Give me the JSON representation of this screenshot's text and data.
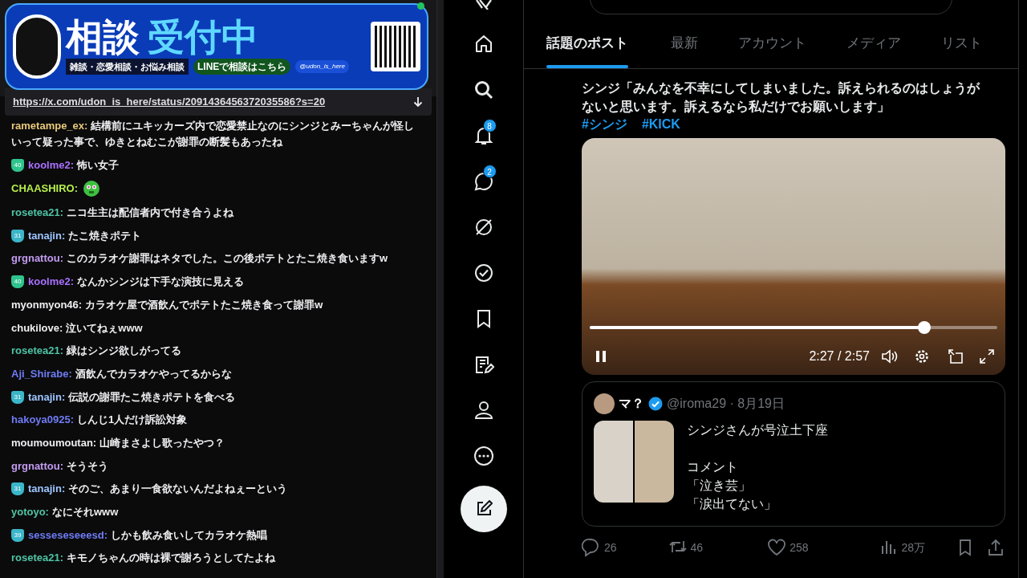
{
  "overlay_banner": {
    "title_left": "相談",
    "title_right": "受付中",
    "subtitle": "雑談・恋愛相談・お悩み相談",
    "line_button": "LINEで相談はこちら",
    "x_handle": "@udon_is_here"
  },
  "chat": {
    "pinned_link": "https://x.com/udon_is_here/status/2091436456372035586?s=20",
    "messages": [
      {
        "kind": "text",
        "user": "rametampe_ex:",
        "color": "#e8c97a",
        "text": "結構前にユキッカーズ内で恋愛禁止なのにシンジとみーちゃんが怪しいって疑った事で、ゆきとねむこが謝罪の断髪もあったね"
      },
      {
        "kind": "text",
        "user": "koolme2:",
        "color": "#a970ff",
        "badge": {
          "text": "40",
          "color": "#2fc48d"
        },
        "text": "怖い女子"
      },
      {
        "kind": "emote",
        "user": "CHAASHIRO:",
        "color": "#b7ef4b"
      },
      {
        "kind": "text",
        "user": "rosetea21:",
        "color": "#4fc4a4",
        "text": "ニコ生主は配信者内で付き合うよね"
      },
      {
        "kind": "text",
        "user": "tanajin:",
        "color": "#9ec6ff",
        "badge": {
          "text": "31",
          "color": "#3bb6c9"
        },
        "text": "たこ焼きポテト"
      },
      {
        "kind": "text",
        "user": "grgnattou:",
        "color": "#c49cf0",
        "text": "このカラオケ謝罪はネタでした。この後ポテトとたこ焼き食いますw"
      },
      {
        "kind": "text",
        "user": "koolme2:",
        "color": "#a970ff",
        "badge": {
          "text": "40",
          "color": "#2fc48d"
        },
        "text": "なんかシンジは下手な演技に見える"
      },
      {
        "kind": "text",
        "user": "myonmyon46:",
        "color": "#efeff1",
        "text": "カラオケ屋で酒飲んでポテトたこ焼き食って謝罪w"
      },
      {
        "kind": "text",
        "user": "chukilove:",
        "color": "#efeff1",
        "text": "泣いてねぇwww"
      },
      {
        "kind": "text",
        "user": "rosetea21:",
        "color": "#4fc4a4",
        "text": "緑はシンジ欲しがってる"
      },
      {
        "kind": "text",
        "user": "Aji_Shirabe:",
        "color": "#6f7cf5",
        "text": "酒飲んでカラオケやってるからな"
      },
      {
        "kind": "text",
        "user": "tanajin:",
        "color": "#9ec6ff",
        "badge": {
          "text": "31",
          "color": "#3bb6c9"
        },
        "text": "伝説の謝罪たこ焼きポテトを食べる"
      },
      {
        "kind": "text",
        "user": "hakoya0925:",
        "color": "#6f7cf5",
        "text": "しんじ1人だけ訴訟対象"
      },
      {
        "kind": "text",
        "user": "moumoumoutan:",
        "color": "#efeff1",
        "text": "山崎まさよし歌ったやつ？"
      },
      {
        "kind": "text",
        "user": "grgnattou:",
        "color": "#c49cf0",
        "text": "そうそう"
      },
      {
        "kind": "text",
        "user": "tanajin:",
        "color": "#9ec6ff",
        "badge": {
          "text": "31",
          "color": "#3bb6c9"
        },
        "text": "そのご、あまり一食欲ないんだよねぇーという"
      },
      {
        "kind": "text",
        "user": "yotoyo:",
        "color": "#4fc4a4",
        "text": "なにそれwww"
      },
      {
        "kind": "text",
        "user": "sesseseseeesd:",
        "color": "#6f7cf5",
        "badge": {
          "text": "39",
          "color": "#3bb6c9"
        },
        "text": "しかも飲み食いしてカラオケ熱唱"
      },
      {
        "kind": "text",
        "user": "rosetea21:",
        "color": "#4fc4a4",
        "text": "キモノちゃんの時は裸で謝ろうとしてたよね"
      }
    ]
  },
  "x_sidebar": {
    "items": [
      {
        "kind": "home"
      },
      {
        "kind": "search"
      },
      {
        "kind": "notifications",
        "count": "8"
      },
      {
        "kind": "messages",
        "count": "2"
      },
      {
        "kind": "grok"
      },
      {
        "kind": "verified"
      },
      {
        "kind": "bookmarks"
      },
      {
        "kind": "lists"
      },
      {
        "kind": "profile"
      },
      {
        "kind": "more"
      }
    ]
  },
  "tabs": [
    {
      "label": "話題のポスト",
      "selected": true
    },
    {
      "label": "最新",
      "selected": false
    },
    {
      "label": "アカウント",
      "selected": false
    },
    {
      "label": "メディア",
      "selected": false
    },
    {
      "label": "リスト",
      "selected": false
    }
  ],
  "post": {
    "text": "シンジ「みんなを不幸にしてしまいました。訴えられるのはしょうがないと思います。訴えるなら私だけでお願いします」",
    "hashtags": [
      "#シンジ",
      "#KICK"
    ],
    "video": {
      "time": "2:27 / 2:57",
      "level": 0.82,
      "playing": true
    },
    "quote": {
      "name": "マ？",
      "verified": true,
      "handle": "@iroma29 · 8月19日",
      "headline": "シンジさんが号泣土下座",
      "lines": [
        "コメント",
        "「泣き芸」",
        "「涙出てない」"
      ]
    },
    "actions": [
      {
        "kind": "reply",
        "count": "26"
      },
      {
        "kind": "repost",
        "count": "46"
      },
      {
        "kind": "like",
        "count": "258"
      },
      {
        "kind": "views",
        "count": "28万"
      },
      {
        "kind": "bookmark"
      },
      {
        "kind": "share"
      }
    ]
  }
}
